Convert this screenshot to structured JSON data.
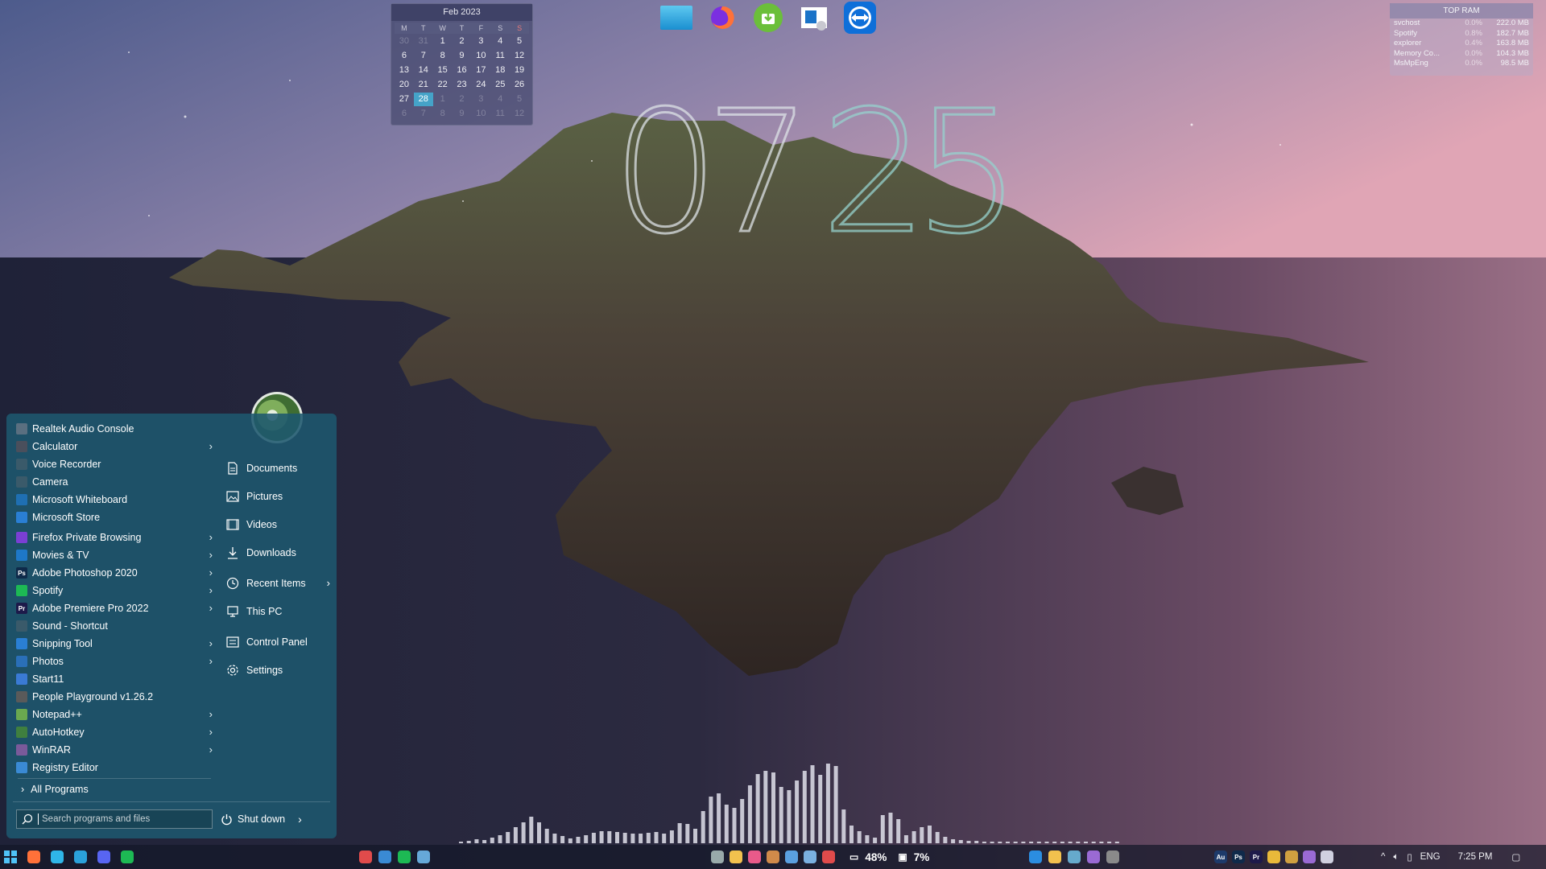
{
  "calendar": {
    "title": "Feb 2023",
    "weekdays": [
      "M",
      "T",
      "W",
      "T",
      "F",
      "S",
      "S"
    ],
    "days": [
      {
        "d": "30",
        "dim": true
      },
      {
        "d": "31",
        "dim": true
      },
      {
        "d": "1"
      },
      {
        "d": "2"
      },
      {
        "d": "3"
      },
      {
        "d": "4"
      },
      {
        "d": "5"
      },
      {
        "d": "6"
      },
      {
        "d": "7"
      },
      {
        "d": "8"
      },
      {
        "d": "9"
      },
      {
        "d": "10"
      },
      {
        "d": "11"
      },
      {
        "d": "12"
      },
      {
        "d": "13"
      },
      {
        "d": "14"
      },
      {
        "d": "15"
      },
      {
        "d": "16"
      },
      {
        "d": "17"
      },
      {
        "d": "18"
      },
      {
        "d": "19"
      },
      {
        "d": "20"
      },
      {
        "d": "21"
      },
      {
        "d": "22"
      },
      {
        "d": "23"
      },
      {
        "d": "24"
      },
      {
        "d": "25"
      },
      {
        "d": "26"
      },
      {
        "d": "27"
      },
      {
        "d": "28",
        "today": true
      },
      {
        "d": "1",
        "dim": true
      },
      {
        "d": "2",
        "dim": true
      },
      {
        "d": "3",
        "dim": true
      },
      {
        "d": "4",
        "dim": true
      },
      {
        "d": "5",
        "dim": true
      },
      {
        "d": "6",
        "dim": true
      },
      {
        "d": "7",
        "dim": true
      },
      {
        "d": "8",
        "dim": true
      },
      {
        "d": "9",
        "dim": true
      },
      {
        "d": "10",
        "dim": true
      },
      {
        "d": "11",
        "dim": true
      },
      {
        "d": "12",
        "dim": true
      }
    ]
  },
  "clock": {
    "hh": "07",
    "mm": "25"
  },
  "topram": {
    "title": "TOP RAM",
    "rows": [
      {
        "name": "svchost",
        "pct": "0.0%",
        "mb": "222.0 MB"
      },
      {
        "name": "Spotify",
        "pct": "0.8%",
        "mb": "182.7 MB"
      },
      {
        "name": "explorer",
        "pct": "0.4%",
        "mb": "163.8 MB"
      },
      {
        "name": "Memory Co...",
        "pct": "0.0%",
        "mb": "104.3 MB"
      },
      {
        "name": "MsMpEng",
        "pct": "0.0%",
        "mb": "98.5 MB"
      }
    ]
  },
  "launcher": [
    {
      "name": "desktop-icon",
      "color": "#2aa7e0"
    },
    {
      "name": "firefox-icon",
      "color": "#ff7139"
    },
    {
      "name": "download-manager-icon",
      "color": "#6bbf3a"
    },
    {
      "name": "remote-desktop-icon",
      "color": "#1a73c8"
    },
    {
      "name": "teamviewer-icon",
      "color": "#0e6fd9"
    }
  ],
  "startmenu": {
    "programs": [
      {
        "label": "Realtek Audio Console",
        "icon": "realtek-icon",
        "color": "#5a6f80",
        "sub": false
      },
      {
        "label": "Calculator",
        "icon": "calculator-icon",
        "color": "#4a4f5c",
        "sub": true
      },
      {
        "label": "Voice Recorder",
        "icon": "voice-recorder-icon",
        "color": "#3a5a6a",
        "sub": false
      },
      {
        "label": "Camera",
        "icon": "camera-icon",
        "color": "#3a5a6a",
        "sub": false
      },
      {
        "label": "Microsoft Whiteboard",
        "icon": "whiteboard-icon",
        "color": "#1f6fb2",
        "sub": false
      },
      {
        "label": "Microsoft Store",
        "icon": "store-icon",
        "color": "#2a7fd4",
        "sub": false
      },
      {
        "sep": true
      },
      {
        "label": "Firefox Private Browsing",
        "icon": "firefox-private-icon",
        "color": "#7a3fd4",
        "sub": true
      },
      {
        "label": "Movies & TV",
        "icon": "movies-icon",
        "color": "#1e78c8",
        "sub": true
      },
      {
        "label": "Adobe Photoshop 2020",
        "icon": "photoshop-icon",
        "color": "#0f2a4a",
        "text": "Ps",
        "sub": true
      },
      {
        "label": "Spotify",
        "icon": "spotify-icon",
        "color": "#1db954",
        "sub": true
      },
      {
        "label": "Adobe Premiere Pro 2022",
        "icon": "premiere-icon",
        "color": "#1d1a4a",
        "text": "Pr",
        "sub": true
      },
      {
        "label": "Sound - Shortcut",
        "icon": "sound-icon",
        "color": "#3a5a6a",
        "sub": false
      },
      {
        "label": "Snipping Tool",
        "icon": "snipping-icon",
        "color": "#2a7fd4",
        "sub": true
      },
      {
        "label": "Photos",
        "icon": "photos-icon",
        "color": "#2a6fb8",
        "sub": true
      },
      {
        "label": "Start11",
        "icon": "start11-icon",
        "color": "#3a7ad4",
        "sub": false
      },
      {
        "label": "People Playground v1.26.2",
        "icon": "people-playground-icon",
        "color": "#5a5a5a",
        "sub": false
      },
      {
        "label": "Notepad++",
        "icon": "notepadpp-icon",
        "color": "#6aa84f",
        "sub": true
      },
      {
        "label": "AutoHotkey",
        "icon": "autohotkey-icon",
        "color": "#3f7f3f",
        "sub": true
      },
      {
        "label": "WinRAR",
        "icon": "winrar-icon",
        "color": "#7a5a9a",
        "sub": true
      },
      {
        "label": "Registry Editor",
        "icon": "regedit-icon",
        "color": "#3a8ad4",
        "sub": false
      }
    ],
    "all_programs": "All Programs",
    "search_placeholder": "Search programs and files",
    "places": [
      {
        "label": "Documents",
        "icon": "document-icon",
        "sub": false
      },
      {
        "label": "Pictures",
        "icon": "pictures-icon",
        "sub": false
      },
      {
        "label": "Videos",
        "icon": "videos-icon",
        "sub": false
      },
      {
        "label": "Downloads",
        "icon": "downloads-icon",
        "sub": false
      },
      {
        "gap": true
      },
      {
        "label": "Recent Items",
        "icon": "clock-icon",
        "sub": true
      },
      {
        "label": "This PC",
        "icon": "pc-icon",
        "sub": false
      },
      {
        "gap": true
      },
      {
        "label": "Control Panel",
        "icon": "control-panel-icon",
        "sub": false
      },
      {
        "label": "Settings",
        "icon": "gear-icon",
        "sub": false
      }
    ],
    "shutdown": "Shut down"
  },
  "visualizer_levels": [
    0.02,
    0.03,
    0.05,
    0.04,
    0.07,
    0.1,
    0.14,
    0.2,
    0.26,
    0.33,
    0.26,
    0.18,
    0.12,
    0.09,
    0.06,
    0.08,
    0.1,
    0.13,
    0.15,
    0.15,
    0.14,
    0.13,
    0.12,
    0.12,
    0.13,
    0.14,
    0.12,
    0.16,
    0.25,
    0.24,
    0.18,
    0.4,
    0.58,
    0.62,
    0.48,
    0.44,
    0.55,
    0.72,
    0.86,
    0.9,
    0.88,
    0.7,
    0.66,
    0.78,
    0.9,
    0.97,
    0.85,
    0.99,
    0.96,
    0.42,
    0.22,
    0.15,
    0.1,
    0.07,
    0.35,
    0.38,
    0.3,
    0.1,
    0.15,
    0.2,
    0.22,
    0.14,
    0.08,
    0.05,
    0.04,
    0.03,
    0.03,
    0.02,
    0.02,
    0.02,
    0.02,
    0.02,
    0.02,
    0.02,
    0.02,
    0.02,
    0.02,
    0.02,
    0.02,
    0.02,
    0.02,
    0.02,
    0.02,
    0.02,
    0.02
  ],
  "taskbar": {
    "left": [
      {
        "name": "start-icon",
        "color": "#4fc3f7"
      },
      {
        "name": "firefox-icon",
        "color": "#ff7139"
      },
      {
        "name": "edge-icon",
        "color": "#2fb6e8"
      },
      {
        "name": "telegram-icon",
        "color": "#2aa1da"
      },
      {
        "name": "discord-icon",
        "color": "#5865f2"
      },
      {
        "name": "spotify-icon",
        "color": "#1db954"
      }
    ],
    "mid1": [
      {
        "name": "lunacy-icon",
        "color": "#e04b4b"
      },
      {
        "name": "snip-icon",
        "color": "#3a8ad4"
      },
      {
        "name": "spotify-icon",
        "color": "#1db954"
      },
      {
        "name": "steam-icon",
        "color": "#66a8d8"
      }
    ],
    "mid2": [
      {
        "name": "calc-icon",
        "color": "#9aa"
      },
      {
        "name": "file-explorer-icon",
        "color": "#f2c14e"
      },
      {
        "name": "paint-icon",
        "color": "#e85a8a"
      },
      {
        "name": "tool-icon",
        "color": "#d08a4a"
      },
      {
        "name": "window-icon",
        "color": "#5aa0e0"
      },
      {
        "name": "window2-icon",
        "color": "#7ab0e0"
      },
      {
        "name": "check-icon",
        "color": "#e04b4b"
      }
    ],
    "gpu_label": "48%",
    "cpu_label": "7%",
    "right": [
      {
        "name": "vscode-icon",
        "color": "#2b8de0"
      },
      {
        "name": "grid-icon",
        "color": "#f2c14e"
      },
      {
        "name": "git-icon",
        "color": "#6ac"
      },
      {
        "name": "visual-studio-icon",
        "color": "#9a6ad4"
      },
      {
        "name": "terminal-icon",
        "color": "#8a8a8a"
      }
    ],
    "tray": [
      {
        "name": "audition-icon",
        "color": "#1d3a6a",
        "text": "Au"
      },
      {
        "name": "photoshop-icon",
        "color": "#0f2a4a",
        "text": "Ps"
      },
      {
        "name": "premiere-icon",
        "color": "#1d1a4a",
        "text": "Pr"
      },
      {
        "name": "chrome-icon",
        "color": "#e8b93a"
      },
      {
        "name": "pen-icon",
        "color": "#d0a040"
      },
      {
        "name": "feather-icon",
        "color": "#9a6ad4"
      },
      {
        "name": "tray-app-icon",
        "color": "#d0d0e0"
      }
    ],
    "lang": "ENG",
    "time": "7:25 PM"
  }
}
